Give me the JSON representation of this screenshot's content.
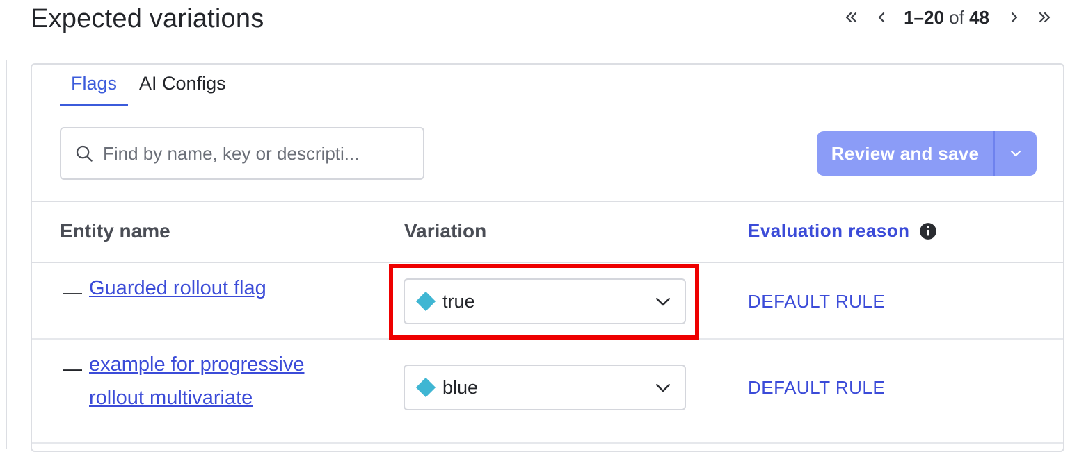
{
  "page": {
    "title": "Expected variations"
  },
  "pagination": {
    "first_icon": "double-chevron-left-icon",
    "prev_icon": "chevron-left-icon",
    "range_start_end": "1–20",
    "of_word": "of",
    "total": "48",
    "next_icon": "chevron-right-icon",
    "last_icon": "double-chevron-right-icon"
  },
  "tabs": [
    {
      "label": "Flags",
      "active": true
    },
    {
      "label": "AI Configs",
      "active": false
    }
  ],
  "search": {
    "placeholder": "Find by name, key or descripti...",
    "value": "",
    "icon": "search-icon"
  },
  "actions": {
    "review_label": "Review and save",
    "review_disabled_color": "#8b9cf7",
    "menu_icon": "chevron-down-icon"
  },
  "table": {
    "columns": {
      "entity": "Entity name",
      "variation": "Variation",
      "reason": "Evaluation reason",
      "reason_icon": "info-icon"
    },
    "rows": [
      {
        "prefix": "—",
        "entity_name": "Guarded rollout flag",
        "variation": "true",
        "variation_color": "#3fb6d3",
        "reason": "DEFAULT RULE",
        "highlighted": true
      },
      {
        "prefix": "—",
        "entity_name": "example for progressive rollout multivariate",
        "variation": "blue",
        "variation_color": "#3fb6d3",
        "reason": "DEFAULT RULE",
        "highlighted": false
      }
    ]
  },
  "colors": {
    "accent": "#3b5bdb",
    "link": "#3b4bd8",
    "highlight": "#ee0000"
  }
}
